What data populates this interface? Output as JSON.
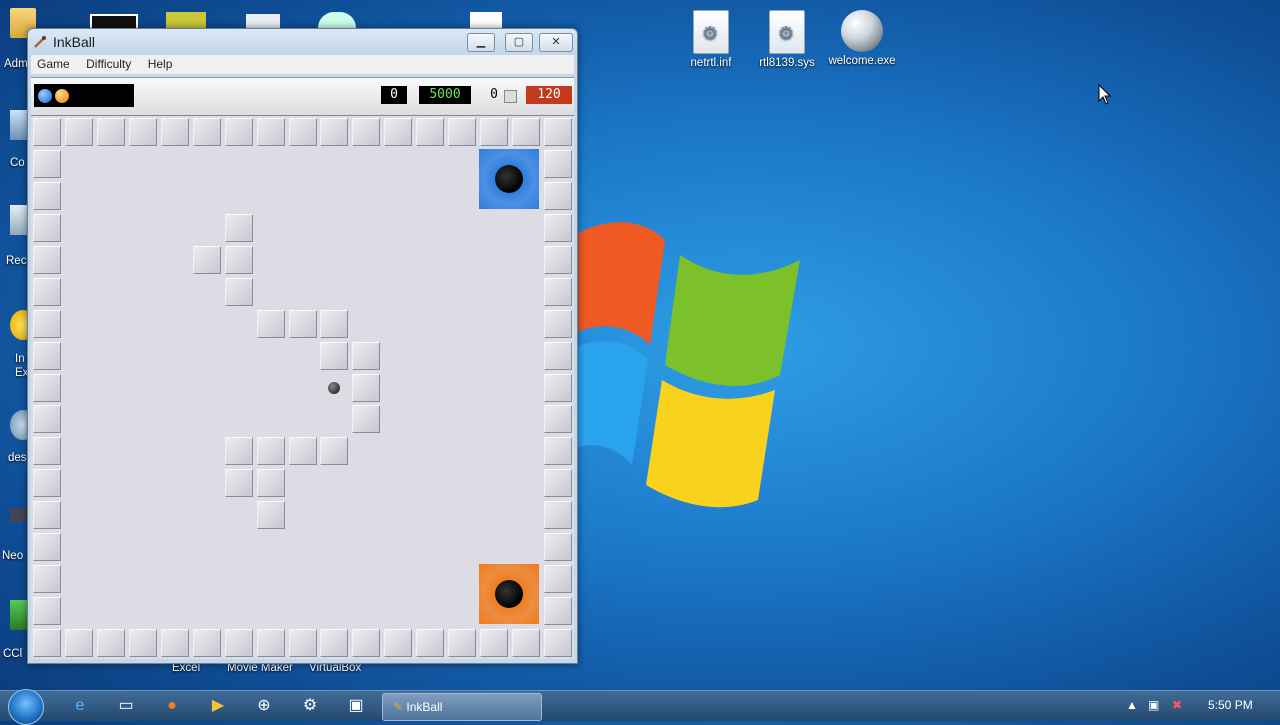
{
  "desktop": {
    "top_icons": [
      {
        "label": "netrtl.inf",
        "icon": "file-gear-icon"
      },
      {
        "label": "rtl8139.sys",
        "icon": "file-gear-icon"
      },
      {
        "label": "welcome.exe",
        "icon": "globe-icon"
      }
    ],
    "left_labels": [
      "Adm",
      "Co",
      "Rec",
      "In",
      "Ex",
      "des",
      "Neo",
      "CCl"
    ],
    "below_window_labels": [
      "Excel",
      "Movie Maker",
      "VirtualBox"
    ]
  },
  "window": {
    "title": "InkBall",
    "controls": [
      "minimize",
      "maximize",
      "close"
    ],
    "menu": [
      "Game",
      "Difficulty",
      "Help"
    ]
  },
  "scorebar": {
    "queue_balls": [
      "blue",
      "orange"
    ],
    "score": "0",
    "high_score": "5000",
    "balls_sunk": "0",
    "time": "120"
  },
  "board": {
    "grid_size": 17,
    "colors": {
      "blue_hole": "#2a7de1",
      "orange_hole": "#f07a1a",
      "tile": "#d6d6de",
      "floor": "#dcdce5"
    },
    "holes": [
      {
        "color": "blue",
        "row": 1,
        "col": 14
      },
      {
        "color": "orange",
        "row": 14,
        "col": 14
      }
    ],
    "ball": {
      "row": 8,
      "col": 9
    },
    "interior_tiles": [
      [
        3,
        6
      ],
      [
        4,
        5
      ],
      [
        4,
        6
      ],
      [
        5,
        6
      ],
      [
        6,
        7
      ],
      [
        6,
        8
      ],
      [
        6,
        9
      ],
      [
        7,
        9
      ],
      [
        7,
        10
      ],
      [
        8,
        10
      ],
      [
        9,
        10
      ],
      [
        10,
        6
      ],
      [
        10,
        7
      ],
      [
        10,
        8
      ],
      [
        10,
        9
      ],
      [
        11,
        6
      ],
      [
        11,
        7
      ],
      [
        12,
        7
      ]
    ]
  },
  "taskbar": {
    "active_task": "InkBall",
    "pinned": [
      "ie-icon",
      "explorer-icon",
      "firefox-icon",
      "media-player-icon",
      "network-icon",
      "tools-icon",
      "window-icon"
    ],
    "clock": "5:50 PM"
  }
}
